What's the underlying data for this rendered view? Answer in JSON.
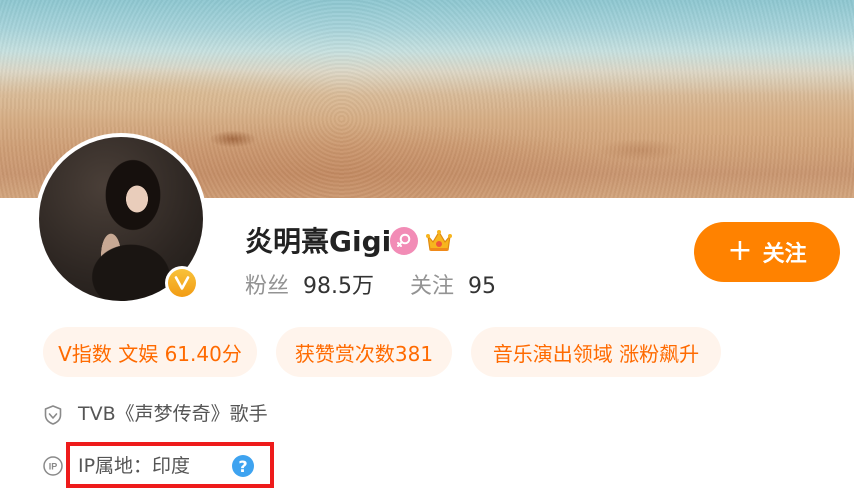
{
  "profile": {
    "name": "炎明熹Gigi",
    "followers_label": "粉丝",
    "followers_value": "98.5万",
    "following_label": "关注",
    "following_value": "95",
    "follow_button": "关注"
  },
  "tags": [
    {
      "label": "V指数 文娱 61.40分"
    },
    {
      "label": "获赞赏次数381"
    },
    {
      "label": "音乐演出领域 涨粉飙升"
    }
  ],
  "info": {
    "title": "TVB《声梦传奇》歌手",
    "ip_location": "IP属地：印度",
    "ip_icon_text": "IP",
    "help_icon_text": "?"
  },
  "colors": {
    "accent": "#ff8200",
    "tag_text": "#ff6a00",
    "tag_bg": "#fff4ec",
    "highlight_box": "#ee1b1b",
    "help": "#3ea3f0"
  },
  "icons": [
    "verified-icon",
    "female-icon",
    "crown-icon",
    "shield-icon",
    "ip-icon",
    "help-icon"
  ]
}
